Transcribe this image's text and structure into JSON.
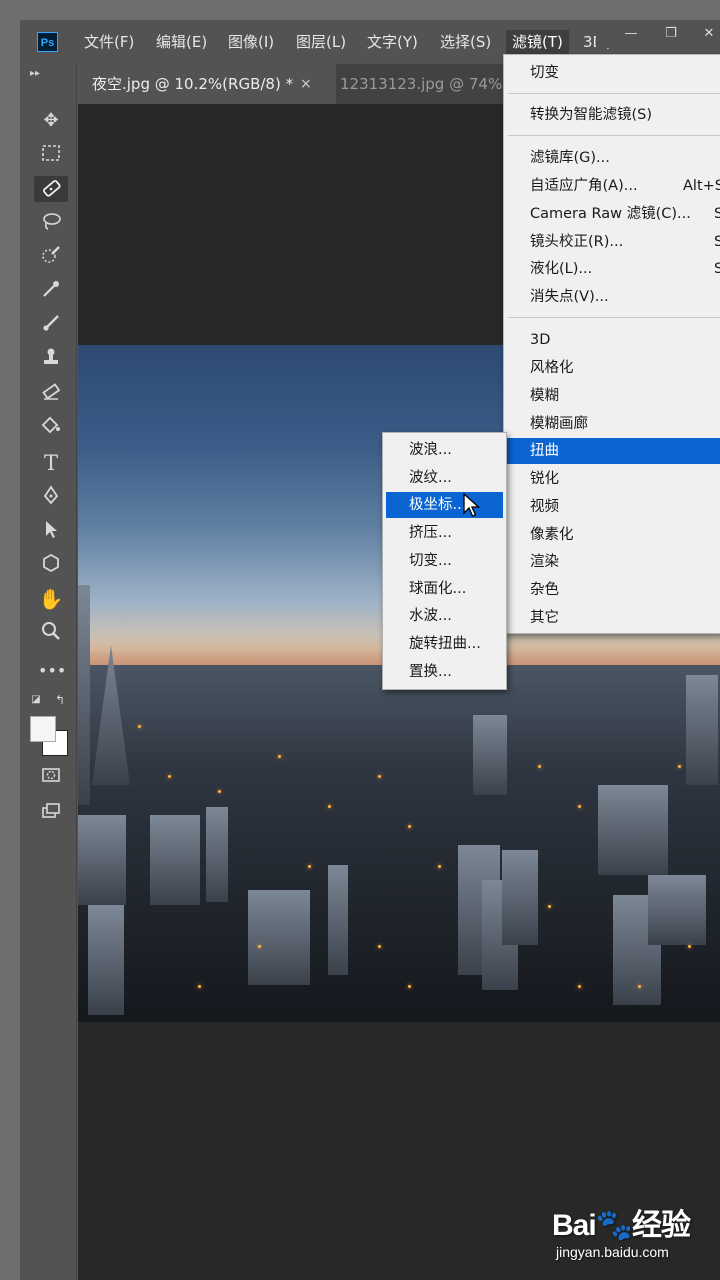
{
  "app": {
    "logo": "Ps"
  },
  "menubar": {
    "items": [
      "文件(F)",
      "编辑(E)",
      "图像(I)",
      "图层(L)",
      "文字(Y)",
      "选择(S)",
      "滤镜(T)",
      "3D("
    ],
    "active": "滤镜(T)"
  },
  "window_controls": {
    "minimize": "—",
    "restore": "❐",
    "close": "✕"
  },
  "tabs": [
    {
      "title": "夜空.jpg @ 10.2%(RGB/8) *",
      "close": "×",
      "active": true
    },
    {
      "title": "12313123.jpg @ 74%(",
      "active": false
    }
  ],
  "tools": [
    "move-icon",
    "marquee-icon",
    "healing-brush-icon",
    "lasso-icon",
    "quick-select-icon",
    "eyedropper-icon",
    "brush-icon",
    "stamp-icon",
    "eraser-icon",
    "paint-bucket-icon",
    "type-icon",
    "pen-icon",
    "path-select-icon",
    "shape-icon",
    "hand-icon",
    "zoom-icon",
    "more-icon",
    "quick-mask-icon",
    "screen-mode-icon"
  ],
  "filter_menu": {
    "items": [
      {
        "label": "切变",
        "shortcut": ""
      },
      {
        "label": "转换为智能滤镜(S)",
        "shortcut": ""
      },
      {
        "label": "滤镜库(G)...",
        "shortcut": ""
      },
      {
        "label": "自适应广角(A)...",
        "shortcut": "Alt+S"
      },
      {
        "label": "Camera Raw 滤镜(C)...",
        "shortcut": "S"
      },
      {
        "label": "镜头校正(R)...",
        "shortcut": "S"
      },
      {
        "label": "液化(L)...",
        "shortcut": "S"
      },
      {
        "label": "消失点(V)...",
        "shortcut": ""
      },
      {
        "label": "3D",
        "shortcut": ""
      },
      {
        "label": "风格化",
        "shortcut": ""
      },
      {
        "label": "模糊",
        "shortcut": ""
      },
      {
        "label": "模糊画廊",
        "shortcut": ""
      },
      {
        "label": "扭曲",
        "shortcut": ""
      },
      {
        "label": "锐化",
        "shortcut": ""
      },
      {
        "label": "视频",
        "shortcut": ""
      },
      {
        "label": "像素化",
        "shortcut": ""
      },
      {
        "label": "渲染",
        "shortcut": ""
      },
      {
        "label": "杂色",
        "shortcut": ""
      },
      {
        "label": "其它",
        "shortcut": ""
      }
    ],
    "highlighted": "扭曲"
  },
  "distort_submenu": {
    "items": [
      "波浪...",
      "波纹...",
      "极坐标...",
      "挤压...",
      "切变...",
      "球面化...",
      "水波...",
      "旋转扭曲...",
      "置换..."
    ],
    "highlighted": "极坐标..."
  },
  "watermark": {
    "main": "Bai🐾经验",
    "sub": "jingyan.baidu.com"
  },
  "colors": {
    "highlight": "#0a64d2",
    "panel": "#535353",
    "canvas": "#282828"
  }
}
